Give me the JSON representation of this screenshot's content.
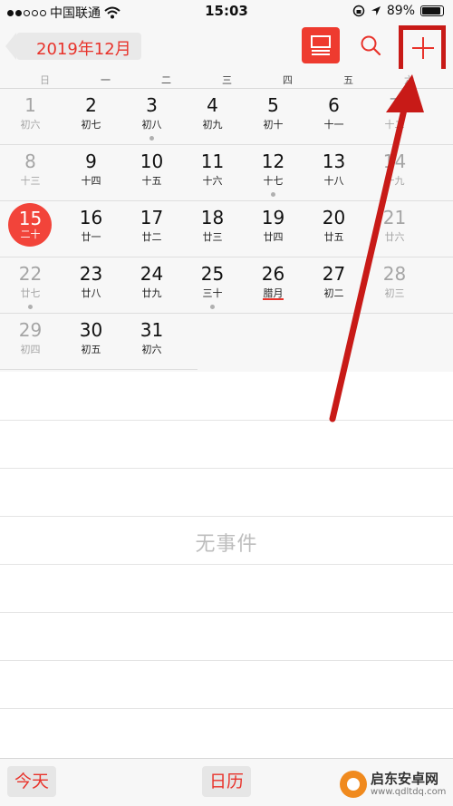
{
  "status_bar": {
    "carrier": "中国联通",
    "time": "15:03",
    "battery": "89%",
    "battery_level": 0.89
  },
  "nav": {
    "back_label": "2019年12月",
    "list_view_icon": "list-view-icon",
    "search_icon": "search-icon",
    "add_icon": "plus-icon"
  },
  "weekdays": [
    "日",
    "一",
    "二",
    "三",
    "四",
    "五",
    "六"
  ],
  "weeks": [
    [
      {
        "num": "1",
        "lunar": "初六",
        "weekend": true
      },
      {
        "num": "2",
        "lunar": "初七"
      },
      {
        "num": "3",
        "lunar": "初八",
        "event": true
      },
      {
        "num": "4",
        "lunar": "初九"
      },
      {
        "num": "5",
        "lunar": "初十"
      },
      {
        "num": "6",
        "lunar": "十一"
      },
      {
        "num": "7",
        "lunar": "十二",
        "weekend": true
      }
    ],
    [
      {
        "num": "8",
        "lunar": "十三",
        "weekend": true
      },
      {
        "num": "9",
        "lunar": "十四"
      },
      {
        "num": "10",
        "lunar": "十五"
      },
      {
        "num": "11",
        "lunar": "十六"
      },
      {
        "num": "12",
        "lunar": "十七",
        "event": true
      },
      {
        "num": "13",
        "lunar": "十八"
      },
      {
        "num": "14",
        "lunar": "十九",
        "weekend": true
      }
    ],
    [
      {
        "num": "15",
        "lunar": "二十",
        "weekend": true,
        "today": true
      },
      {
        "num": "16",
        "lunar": "廿一"
      },
      {
        "num": "17",
        "lunar": "廿二"
      },
      {
        "num": "18",
        "lunar": "廿三"
      },
      {
        "num": "19",
        "lunar": "廿四"
      },
      {
        "num": "20",
        "lunar": "廿五"
      },
      {
        "num": "21",
        "lunar": "廿六",
        "weekend": true
      }
    ],
    [
      {
        "num": "22",
        "lunar": "廿七",
        "weekend": true,
        "event": true
      },
      {
        "num": "23",
        "lunar": "廿八"
      },
      {
        "num": "24",
        "lunar": "廿九"
      },
      {
        "num": "25",
        "lunar": "三十",
        "event": true
      },
      {
        "num": "26",
        "lunar": "腊月",
        "festival": true
      },
      {
        "num": "27",
        "lunar": "初二"
      },
      {
        "num": "28",
        "lunar": "初三",
        "weekend": true
      }
    ],
    [
      {
        "num": "29",
        "lunar": "初四",
        "weekend": true
      },
      {
        "num": "30",
        "lunar": "初五"
      },
      {
        "num": "31",
        "lunar": "初六"
      }
    ]
  ],
  "events_list": {
    "empty_text": "无事件"
  },
  "toolbar": {
    "today_label": "今天",
    "calendars_label": "日历"
  },
  "watermark": {
    "brand": "启东安卓网",
    "url": "www.qdltdq.com"
  },
  "colors": {
    "accent": "#e8332b",
    "annotation": "#c81a17"
  }
}
